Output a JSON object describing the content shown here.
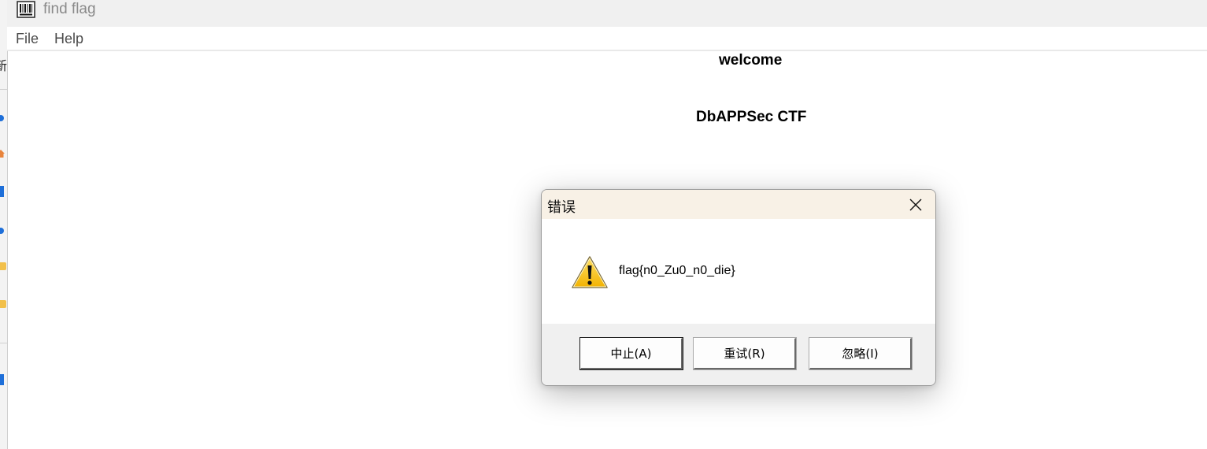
{
  "window": {
    "title": "find flag",
    "icon": "barcode-icon"
  },
  "menu": {
    "items": [
      "File",
      "Help"
    ]
  },
  "background_window": {
    "partial_text": "新"
  },
  "content": {
    "welcome": "welcome",
    "subtitle": "DbAPPSec CTF"
  },
  "dialog": {
    "title": "错误",
    "message": "flag{n0_Zu0_n0_die}",
    "icon": "warning-icon",
    "buttons": {
      "abort": "中止(A)",
      "retry": "重试(R)",
      "ignore": "忽略(I)"
    },
    "colors": {
      "titlebar": "#f8f1e6",
      "footer": "#f0f0f0"
    }
  }
}
